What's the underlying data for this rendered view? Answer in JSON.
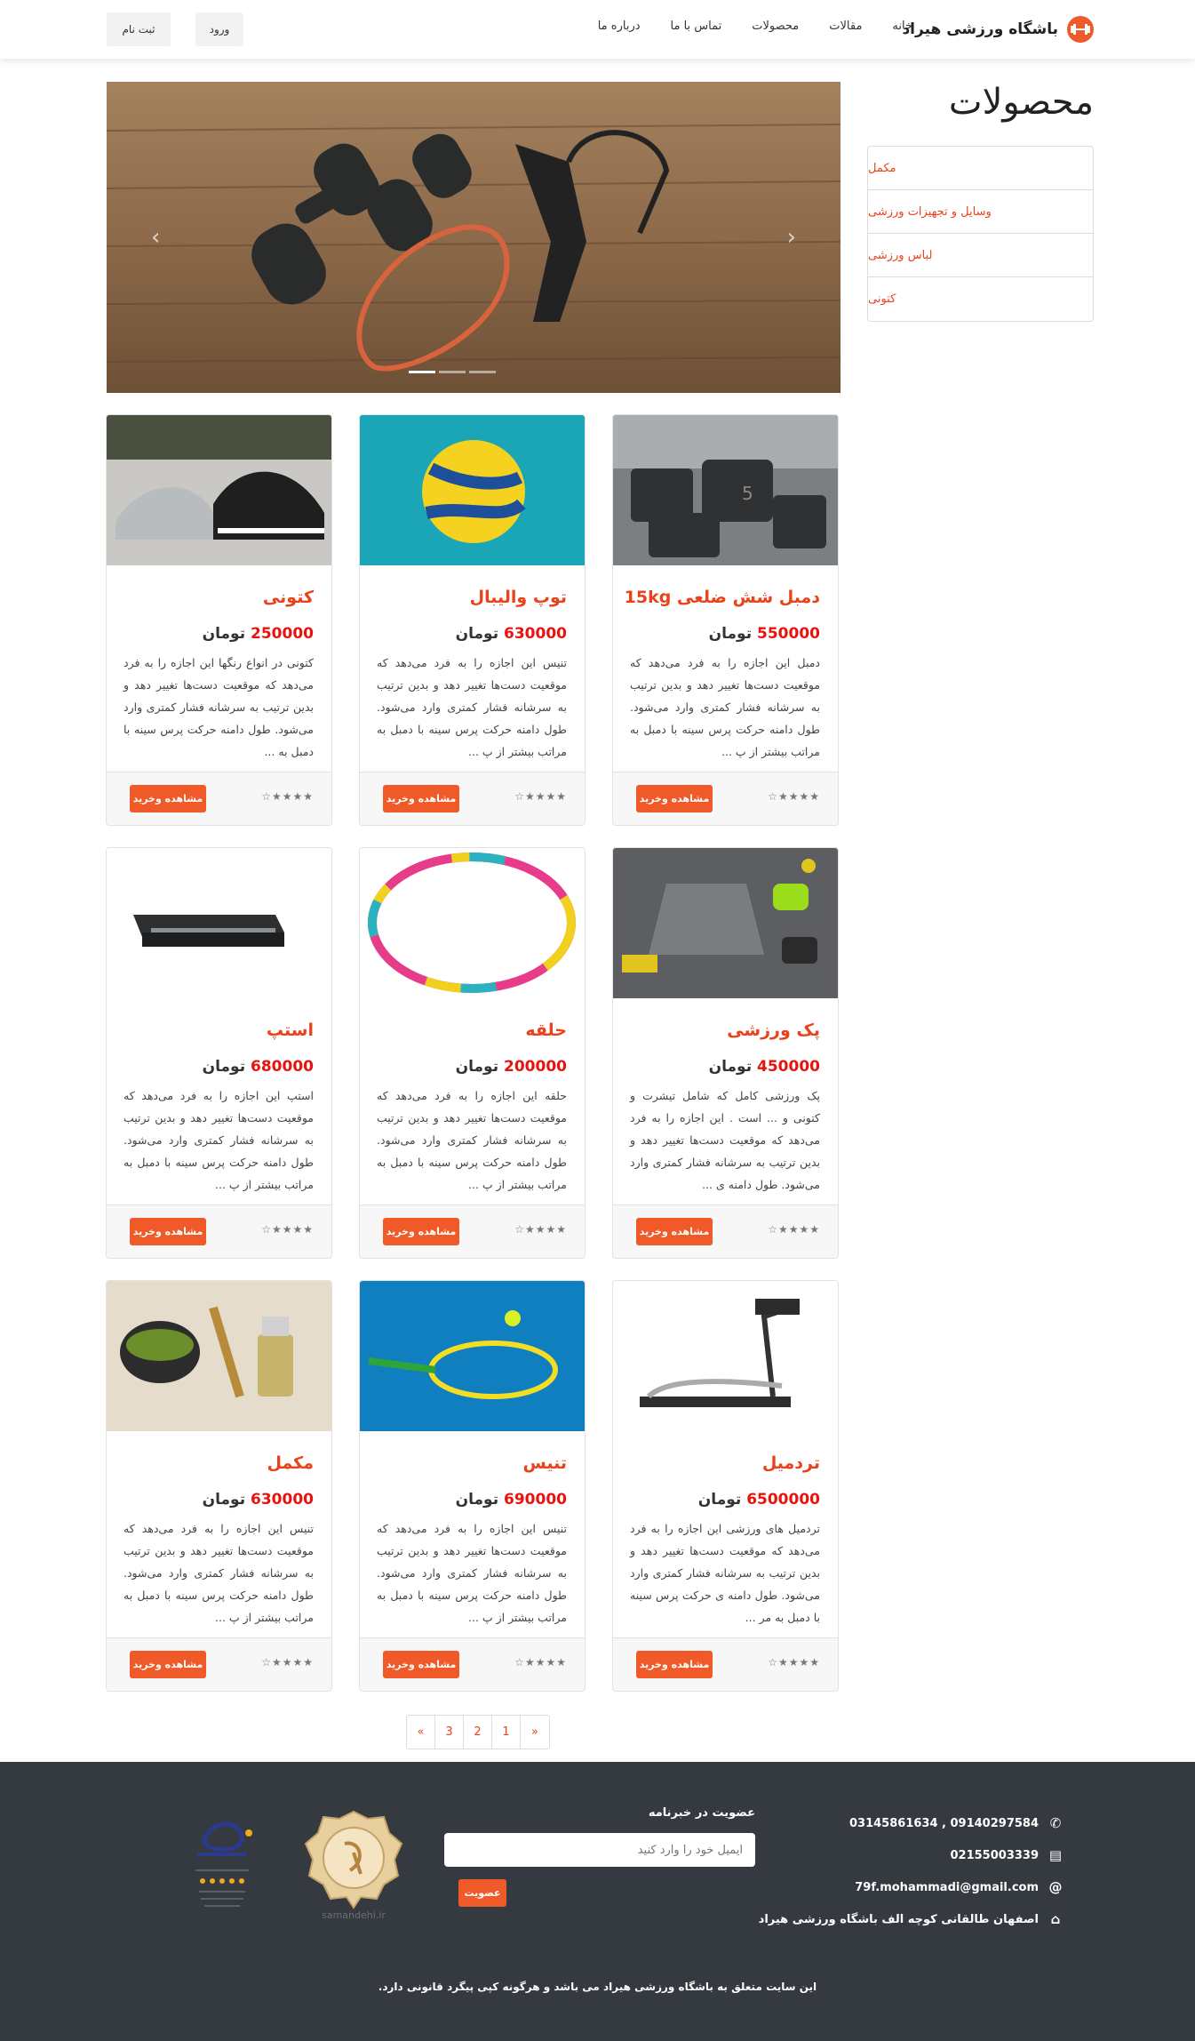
{
  "navbar": {
    "brand": "باشگاه ورزشی هیراد",
    "links": [
      "خانه",
      "مقالات",
      "محصولات",
      "تماس با ما",
      "درباره ما"
    ],
    "login": "ورود",
    "register": "ثبت نام"
  },
  "sidebar": {
    "title": "محصولات",
    "items": [
      "مکمل",
      "وسایل و تجهیزات ورزشی",
      "لباس ورزشی",
      "کتونی"
    ]
  },
  "carousel": {
    "prev_icon": "chevron-left-icon",
    "next_icon": "chevron-right-icon",
    "slide_count": 3,
    "active_slide": 1
  },
  "products": [
    {
      "title": "دمبل شش ضلعی 15kg",
      "price": "550000",
      "currency": "تومان",
      "desc": "دمبل این اجازه را به فرد می‌دهد که موقعیت دست‌ها تغییر دهد و بدین ترتیب به سرشانه فشار کمتری وارد می‌شود. طول دامنه حرکت پرس سینه با دمبل به مراتب بیشتر از پ ...",
      "button": "مشاهده وخرید",
      "stars": "☆★★★★"
    },
    {
      "title": "توپ والیبال",
      "price": "630000",
      "currency": "تومان",
      "desc": "تنیس این اجازه را به فرد می‌دهد که موقعیت دست‌ها تغییر دهد و بدین ترتیب به سرشانه فشار کمتری وارد می‌شود. طول دامنه حرکت پرس سینه با دمبل به مراتب بیشتر از پ ...",
      "button": "مشاهده وخرید",
      "stars": "☆★★★★"
    },
    {
      "title": "کتونی",
      "price": "250000",
      "currency": "تومان",
      "desc": "کتونی در انواع رنگها این اجازه را به فرد می‌دهد که موقعیت دست‌ها تغییر دهد و بدین ترتیب به سرشانه فشار کمتری وارد می‌شود. طول دامنه حرکت پرس سینه با دمبل به ...",
      "button": "مشاهده وخرید",
      "stars": "☆★★★★"
    },
    {
      "title": "پک ورزشی",
      "price": "450000",
      "currency": "تومان",
      "desc": "پک ورزشی کامل که شامل تیشرت و کتونی و ... است . این اجازه را به فرد می‌دهد که موقعیت دست‌ها تغییر دهد و بدین ترتیب به سرشانه فشار کمتری وارد می‌شود. طول دامنه ی ...",
      "button": "مشاهده وخرید",
      "stars": "☆★★★★"
    },
    {
      "title": "حلقه",
      "price": "200000",
      "currency": "تومان",
      "desc": "حلقه این اجازه را به فرد می‌دهد که موقعیت دست‌ها تغییر دهد و بدین ترتیب به سرشانه فشار کمتری وارد می‌شود. طول دامنه حرکت پرس سینه با دمبل به مراتب بیشتر از پ ...",
      "button": "مشاهده وخرید",
      "stars": "☆★★★★"
    },
    {
      "title": "استپ",
      "price": "680000",
      "currency": "تومان",
      "desc": "استپ این اجازه را به فرد می‌دهد که موقعیت دست‌ها تغییر دهد و بدین ترتیب به سرشانه فشار کمتری وارد می‌شود. طول دامنه حرکت پرس سینه با دمبل به مراتب بیشتر از پ ...",
      "button": "مشاهده وخرید",
      "stars": "☆★★★★"
    },
    {
      "title": "تردمیل",
      "price": "6500000",
      "currency": "تومان",
      "desc": "تردمیل های ورزشی این اجازه را به فرد می‌دهد که موقعیت دست‌ها تغییر دهد و بدین ترتیب به سرشانه فشار کمتری وارد می‌شود. طول دامنه ی حرکت پرس سینه با دمبل به مر ...",
      "button": "مشاهده وخرید",
      "stars": "☆★★★★"
    },
    {
      "title": "تنیس",
      "price": "690000",
      "currency": "تومان",
      "desc": "تنیس این اجازه را به فرد می‌دهد که موقعیت دست‌ها تغییر دهد و بدین ترتیب به سرشانه فشار کمتری وارد می‌شود. طول دامنه حرکت پرس سینه با دمبل به مراتب بیشتر از پ ...",
      "button": "مشاهده وخرید",
      "stars": "☆★★★★"
    },
    {
      "title": "مکمل",
      "price": "630000",
      "currency": "تومان",
      "desc": "تنیس این اجازه را به فرد می‌دهد که موقعیت دست‌ها تغییر دهد و بدین ترتیب به سرشانه فشار کمتری وارد می‌شود. طول دامنه حرکت پرس سینه با دمبل به مراتب بیشتر از پ ...",
      "button": "مشاهده وخرید",
      "stars": "☆★★★★"
    }
  ],
  "pagination": [
    "«",
    "3",
    "2",
    "1",
    "»"
  ],
  "footer": {
    "phone": "09140297584 , 03145861634",
    "fax": "02155003339",
    "email": "79f.mohammadi@gmail.com",
    "address": "اصفهان طالقانی کوچه الف باشگاه ورزشی هیراد",
    "newsletter_title": "عضویت در خبرنامه",
    "newsletter_placeholder": "ایمیل خود را وارد کنید",
    "newsletter_button": "عضویت",
    "samandehi_text": "samandehi.ir",
    "copyright": "این سایت متعلق به باشگاه ورزشی هیراد می باشد و هرگونه کپی پیگرد قانونی دارد."
  },
  "colors": {
    "accent": "#f05a28",
    "price": "#e8130e",
    "footer_bg": "#343a40"
  }
}
